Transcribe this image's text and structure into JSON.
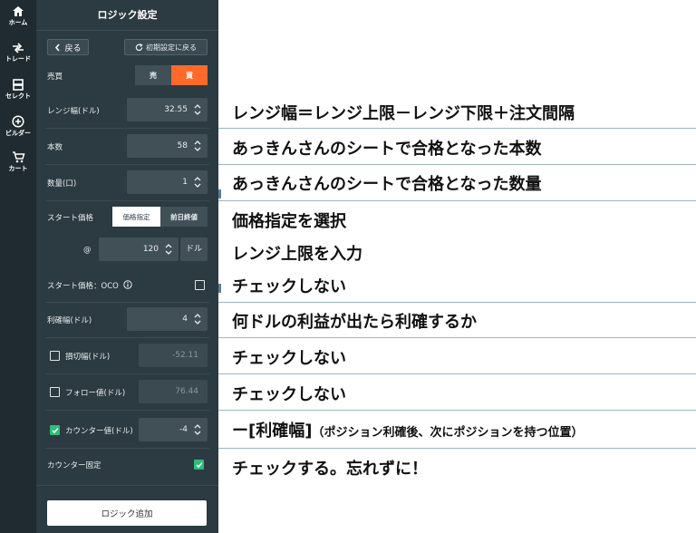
{
  "rail": {
    "items": [
      {
        "label": "ホーム",
        "icon": "home-icon"
      },
      {
        "label": "トレード",
        "icon": "trade-icon"
      },
      {
        "label": "セレクト",
        "icon": "select-icon"
      },
      {
        "label": "ビルダー",
        "icon": "builder-icon"
      },
      {
        "label": "カート",
        "icon": "cart-icon"
      }
    ]
  },
  "panel": {
    "title": "ロジック設定",
    "back_label": "戻る",
    "reset_label": "初期設定に戻る",
    "buysell": {
      "label": "売買",
      "sell": "売",
      "buy": "買",
      "selected": "買"
    },
    "range_width": {
      "label": "レンジ幅(ドル)",
      "value": "32.55"
    },
    "count": {
      "label": "本数",
      "value": "58"
    },
    "quantity": {
      "label": "数量(口)",
      "value": "1"
    },
    "start_price": {
      "label": "スタート価格",
      "opt_price": "価格指定",
      "opt_prev_close": "前日終値",
      "selected": "価格指定"
    },
    "price_input": {
      "prefix": "@",
      "value": "120",
      "unit": "ドル"
    },
    "start_oco": {
      "label": "スタート価格：OCO",
      "checked": false
    },
    "take_profit": {
      "label": "利確幅(ドル)",
      "value": "4"
    },
    "stop_loss": {
      "label": "損切幅(ドル)",
      "value": "-52.11",
      "checked": false
    },
    "follow": {
      "label": "フォロー値(ドル)",
      "value": "76.44",
      "checked": false
    },
    "counter": {
      "label": "カウンター値(ドル)",
      "value": "-4",
      "checked": true
    },
    "counter_fixed": {
      "label": "カウンター固定",
      "checked": true
    },
    "add_label": "ロジック追加"
  },
  "notes": {
    "n1": "レンジ幅＝レンジ上限－レンジ下限＋注文間隔",
    "n2": "あっきんさんのシートで合格となった本数",
    "n3": "あっきんさんのシートで合格となった数量",
    "n4": "価格指定を選択",
    "n5": "レンジ上限を入力",
    "n6": "チェックしない",
    "n7": "何ドルの利益が出たら利確するか",
    "n8": "チェックしない",
    "n9": "チェックしない",
    "n10_main": "ー[利確幅]",
    "n10_sub": "（ポジション利確後、次にポジションを持つ位置）",
    "n11": "チェックする。忘れずに！"
  },
  "colors": {
    "accent": "#ff6a2b",
    "check_green": "#2ebd7a",
    "panel_bg": "#2c3a41",
    "rail_bg": "#1f2b30"
  }
}
